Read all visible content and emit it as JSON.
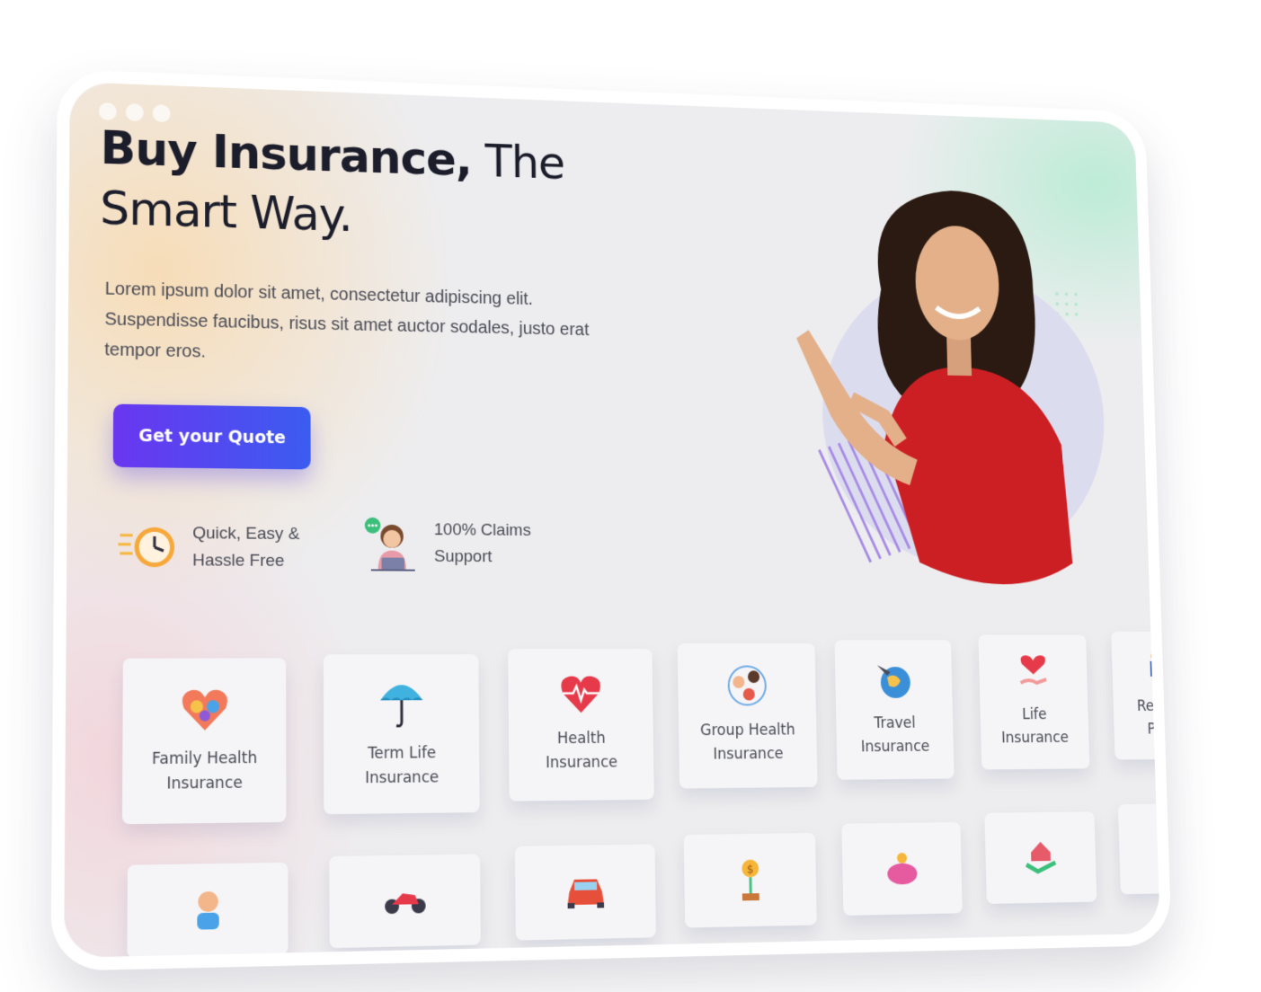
{
  "hero": {
    "title_bold": "Buy Insurance,",
    "title_rest": "The",
    "title_line2": "Smart Way.",
    "description": "Lorem ipsum dolor sit amet, consectetur adipiscing elit. Suspendisse faucibus, risus sit amet auctor sodales, justo erat tempor eros.",
    "cta_label": "Get your Quote"
  },
  "features": [
    {
      "line1": "Quick, Easy &",
      "line2": "Hassle Free",
      "icon": "clock-icon"
    },
    {
      "line1": "100% Claims",
      "line2": "Support",
      "icon": "support-agent-icon"
    }
  ],
  "cards_row1": [
    {
      "line1": "Family Health",
      "line2": "Insurance",
      "icon": "family-heart-icon"
    },
    {
      "line1": "Term Life",
      "line2": "Insurance",
      "icon": "umbrella-icon"
    },
    {
      "line1": "Health",
      "line2": "Insurance",
      "icon": "heartbeat-icon"
    },
    {
      "line1": "Group Health",
      "line2": "Insurance",
      "icon": "group-people-icon"
    },
    {
      "line1": "Travel",
      "line2": "Insurance",
      "icon": "globe-plane-icon"
    },
    {
      "line1": "Life",
      "line2": "Insurance",
      "icon": "heart-hand-icon"
    },
    {
      "line1": "Retiren",
      "line2": "Plan",
      "icon": "elderly-couple-icon"
    }
  ],
  "cards_row2_icons": [
    "baby-icon",
    "motorcycle-icon",
    "car-icon",
    "money-plant-icon",
    "piggy-bank-icon",
    "home-handshake-icon",
    "building-icon"
  ],
  "colors": {
    "accent_start": "#6a36f0",
    "accent_end": "#3b5cf0",
    "title": "#1c1d2b",
    "body": "#4a4b55"
  }
}
